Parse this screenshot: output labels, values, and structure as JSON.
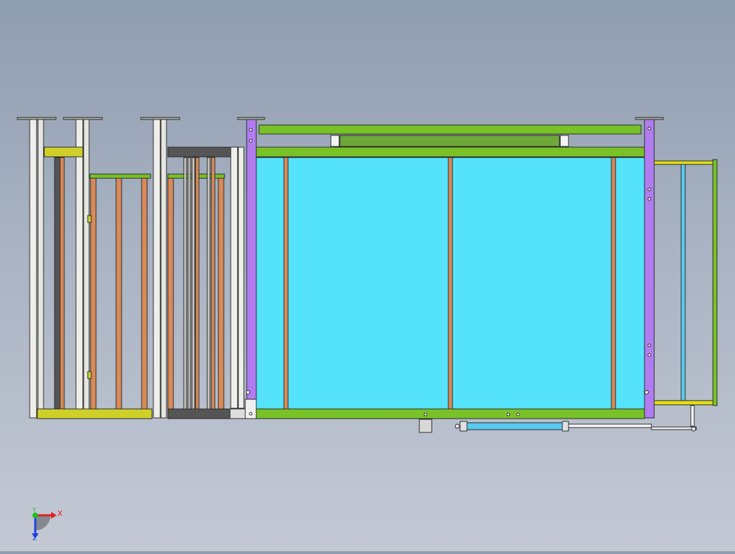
{
  "viewport": {
    "background_top": "#8f9db0",
    "background_bottom": "#c4c9d4"
  },
  "colors": {
    "glass": "#55e3fb",
    "green_rail": "#78c228",
    "purple_post": "#b07cf0",
    "copper_bar": "#d88a58",
    "white_post": "#eeeeea",
    "yellow_block": "#cfcf2a",
    "dark_block": "#555555",
    "cylinder": "#59c9ef",
    "edge": "#2a2a2a"
  },
  "triad": {
    "x_label": "X",
    "y_label": "Y",
    "z_label": "Z",
    "x_color": "#e02020",
    "y_color": "#20c020",
    "z_color": "#2040e0"
  }
}
